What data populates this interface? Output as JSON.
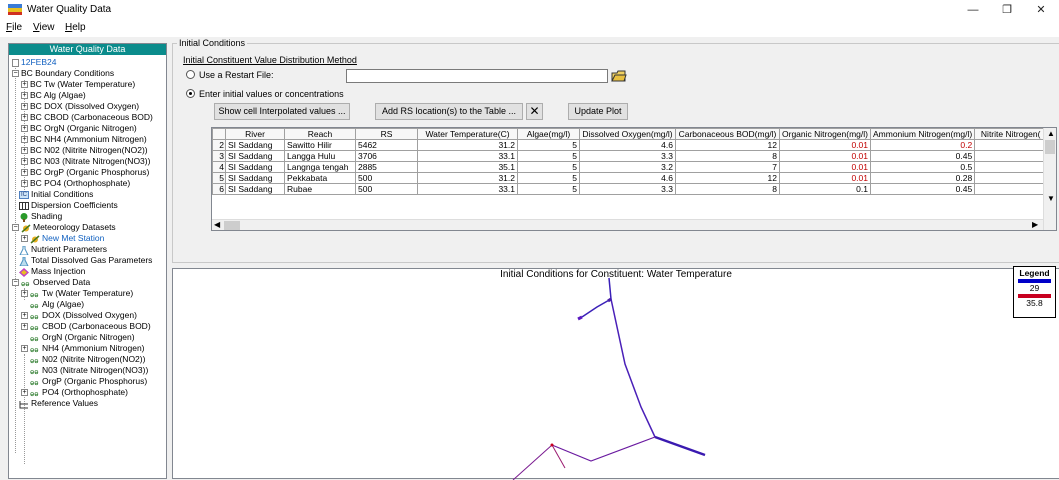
{
  "window": {
    "title": "Water Quality Data",
    "minimize": "—",
    "maximize": "❐",
    "close": "✕"
  },
  "menu": {
    "file": "ile",
    "file_u": "F",
    "view": "iew",
    "view_u": "V",
    "help": "elp",
    "help_u": "H"
  },
  "tree": {
    "header": "Water Quality Data",
    "root": "12FEB24",
    "bc": "BC Boundary Conditions",
    "bc_items": [
      "BC Tw  (Water Temperature)",
      "BC Alg  (Algae)",
      "BC DOX  (Dissolved Oxygen)",
      "BC CBOD  (Carbonaceous BOD)",
      "BC OrgN  (Organic Nitrogen)",
      "BC NH4  (Ammonium Nitrogen)",
      "BC N02  (Nitrite Nitrogen(NO2))",
      "BC N03  (Nitrate Nitrogen(NO3))",
      "BC OrgP  (Organic Phosphorus)",
      "BC PO4  (Orthophosphate)"
    ],
    "initial_conditions": "Initial Conditions",
    "dispersion": "Dispersion Coefficients",
    "shading": "Shading",
    "meteorology": "Meteorology Datasets",
    "met_station": "New Met Station",
    "nutrient": "Nutrient Parameters",
    "tdg": "Total Dissolved Gas Parameters",
    "mass_injection": "Mass Injection",
    "observed": "Observed Data",
    "observed_items": [
      "Tw (Water Temperature)",
      "Alg (Algae)",
      "DOX (Dissolved Oxygen)",
      "CBOD (Carbonaceous BOD)",
      "OrgN (Organic Nitrogen)",
      "NH4 (Ammonium Nitrogen)",
      "N02 (Nitrite Nitrogen(NO2))",
      "N03 (Nitrate Nitrogen(NO3))",
      "OrgP (Organic Phosphorus)",
      "PO4 (Orthophosphate)"
    ],
    "reference": "Reference Values"
  },
  "initial": {
    "group_title": "Initial Conditions",
    "method_label": "Initial Constituent Value Distribution Method",
    "restart_label": "Use a Restart File:",
    "restart_value": "",
    "enter_label": "Enter initial values or concentrations",
    "show_cell_btn": "Show cell Interpolated values ...",
    "add_rs_btn": "Add RS location(s) to the Table ...",
    "delete_btn": "✕",
    "update_btn": "Update Plot"
  },
  "table": {
    "columns": [
      "River",
      "Reach",
      "RS",
      "Water Temperature(C)",
      "Algae(mg/l)",
      "Dissolved Oxygen(mg/l)",
      "Carbonaceous BOD(mg/l)",
      "Organic Nitrogen(mg/l)",
      "Ammonium Nitrogen(mg/l)",
      "Nitrite Nitrogen("
    ],
    "rows": [
      {
        "n": "2",
        "river": "SI Saddang",
        "reach": "Sawitto Hilir",
        "rs": "5462",
        "tw": "31.2",
        "alg": "5",
        "dox": "4.6",
        "cbod": "12",
        "orgn": "0.01",
        "nh4": "0.2"
      },
      {
        "n": "3",
        "river": "SI Saddang",
        "reach": "Langga Hulu",
        "rs": "3706",
        "tw": "33.1",
        "alg": "5",
        "dox": "3.3",
        "cbod": "8",
        "orgn": "0.01",
        "nh4": "0.45"
      },
      {
        "n": "4",
        "river": "SI Saddang",
        "reach": "Langnga tengah",
        "rs": "2885",
        "tw": "35.1",
        "alg": "5",
        "dox": "3.2",
        "cbod": "7",
        "orgn": "0.01",
        "nh4": "0.5"
      },
      {
        "n": "5",
        "river": "SI Saddang",
        "reach": "Pekkabata",
        "rs": "500",
        "tw": "31.2",
        "alg": "5",
        "dox": "4.6",
        "cbod": "12",
        "orgn": "0.01",
        "nh4": "0.28"
      },
      {
        "n": "6",
        "river": "SI Saddang",
        "reach": "Rubae",
        "rs": "500",
        "tw": "33.1",
        "alg": "5",
        "dox": "3.3",
        "cbod": "8",
        "orgn": "0.1",
        "nh4": "0.45"
      }
    ]
  },
  "plot": {
    "title": "Initial Conditions for Constituent: Water Temperature",
    "legend_title": "Legend",
    "legend_min": "29",
    "legend_max": "35.8",
    "colors": {
      "low": "#0000c8",
      "high": "#c80020",
      "mid": "#5a1ac0"
    }
  }
}
